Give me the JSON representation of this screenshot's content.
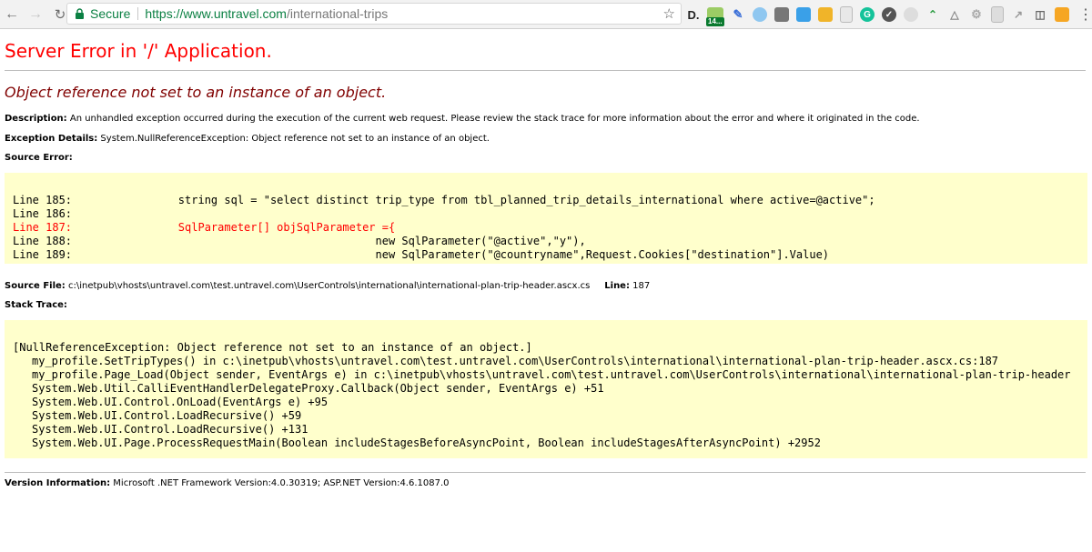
{
  "browser": {
    "secure_label": "Secure",
    "url_host": "https://www.untravel.com",
    "url_path": "/international-trips",
    "extension_badge": "14...",
    "extension_d_label": "D."
  },
  "error": {
    "title": "Server Error in '/' Application.",
    "message": "Object reference not set to an instance of an object.",
    "description_label": "Description:",
    "description_text": " An unhandled exception occurred during the execution of the current web request. Please review the stack trace for more information about the error and where it originated in the code.",
    "exception_label": "Exception Details:",
    "exception_text": " System.NullReferenceException: Object reference not set to an instance of an object.",
    "source_error_label": "Source Error:",
    "source_lines": [
      {
        "num": "Line 185:",
        "code": "        string sql = \"select distinct trip_type from tbl_planned_trip_details_international where active=@active\";"
      },
      {
        "num": "Line 186:",
        "code": ""
      },
      {
        "num": "Line 187:",
        "code": "        SqlParameter[] objSqlParameter ={"
      },
      {
        "num": "Line 188:",
        "code": "                                      new SqlParameter(\"@active\",\"y\"),"
      },
      {
        "num": "Line 189:",
        "code": "                                      new SqlParameter(\"@countryname\",Request.Cookies[\"destination\"].Value)"
      }
    ],
    "source_file_label": "Source File:",
    "source_file_path": " c:\\inetpub\\vhosts\\untravel.com\\test.untravel.com\\UserControls\\international\\international-plan-trip-header.ascx.cs",
    "line_label": "Line:",
    "line_value": " 187",
    "stack_trace_label": "Stack Trace:",
    "stack_lines": [
      "[NullReferenceException: Object reference not set to an instance of an object.]",
      "my_profile.SetTripTypes() in c:\\inetpub\\vhosts\\untravel.com\\test.untravel.com\\UserControls\\international\\international-plan-trip-header.ascx.cs:187",
      "my_profile.Page_Load(Object sender, EventArgs e) in c:\\inetpub\\vhosts\\untravel.com\\test.untravel.com\\UserControls\\international\\international-plan-trip-header",
      "System.Web.Util.CalliEventHandlerDelegateProxy.Callback(Object sender, EventArgs e) +51",
      "System.Web.UI.Control.OnLoad(EventArgs e) +95",
      "System.Web.UI.Control.LoadRecursive() +59",
      "System.Web.UI.Control.LoadRecursive() +131",
      "System.Web.UI.Page.ProcessRequestMain(Boolean includeStagesBeforeAsyncPoint, Boolean includeStagesAfterAsyncPoint) +2952"
    ],
    "version_label": "Version Information:",
    "version_text": " Microsoft .NET Framework Version:4.0.30319; ASP.NET Version:4.6.1087.0"
  },
  "colors": {
    "title_red": "#ff0000",
    "message_maroon": "#800000",
    "code_background": "#ffffcc",
    "secure_green": "#0b8043"
  }
}
